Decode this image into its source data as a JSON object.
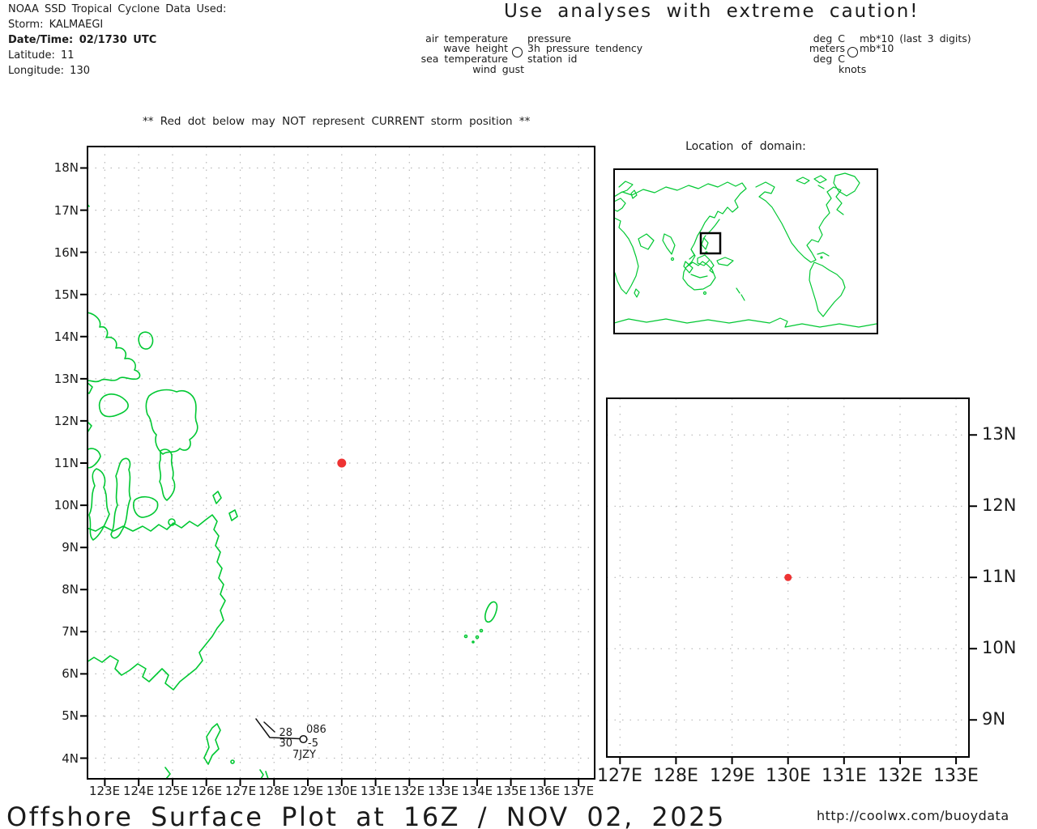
{
  "header": {
    "source": "NOAA SSD Tropical Cyclone Data Used:",
    "storm": "Storm: KALMAEGI",
    "datetime": "Date/Time: 02/1730 UTC",
    "latitude": "Latitude: 11",
    "longitude": "Longitude: 130"
  },
  "caution_banner": "Use analyses with extreme caution!",
  "storm_warning": "** Red dot below may NOT represent CURRENT storm position **",
  "legend": {
    "station_model": {
      "top_left": "air temperature",
      "top_right": "pressure",
      "mid_left": "wave height",
      "mid_right": "3h pressure tendency",
      "bottom_left": "sea temperature",
      "bottom_right": "station id",
      "below": "wind gust"
    },
    "units": {
      "top_left": "deg C",
      "top_right": "mb*10 (last 3 digits)",
      "mid_left": "meters",
      "mid_right": "mb*10",
      "bottom_left": "deg C",
      "below": "knots"
    }
  },
  "world_map": {
    "title": "Location of domain:"
  },
  "main_map": {
    "lat_labels": [
      "18N",
      "17N",
      "16N",
      "15N",
      "14N",
      "13N",
      "12N",
      "11N",
      "10N",
      "9N",
      "8N",
      "7N",
      "6N",
      "5N",
      "4N"
    ],
    "lon_labels": [
      "123E",
      "124E",
      "125E",
      "126E",
      "127E",
      "128E",
      "129E",
      "130E",
      "131E",
      "132E",
      "133E",
      "134E",
      "135E",
      "136E",
      "137E"
    ],
    "storm_dot": {
      "latitude": 11,
      "longitude": 130
    },
    "station_plot": {
      "air_temperature": "28",
      "pressure": "086",
      "sea_temperature": "30",
      "pressure_tendency": "-5",
      "station_id": "7JZY"
    }
  },
  "zoom_map": {
    "lat_labels": [
      "13N",
      "12N",
      "11N",
      "10N",
      "9N"
    ],
    "lon_labels": [
      "127E",
      "128E",
      "129E",
      "130E",
      "131E",
      "132E",
      "133E"
    ],
    "storm_dot": {
      "latitude": 11,
      "longitude": 130
    }
  },
  "footer": {
    "title": "Offshore Surface Plot at 16Z / NOV 02, 2025",
    "url": "http://coolwx.com/buoydata"
  },
  "colors": {
    "coastline_green": "#00c832",
    "storm_dot_red": "#ee3333",
    "alert_red": "#ff4747",
    "salmon_red": "#ff6b6b",
    "grid_gray": "#b8b8b8"
  }
}
